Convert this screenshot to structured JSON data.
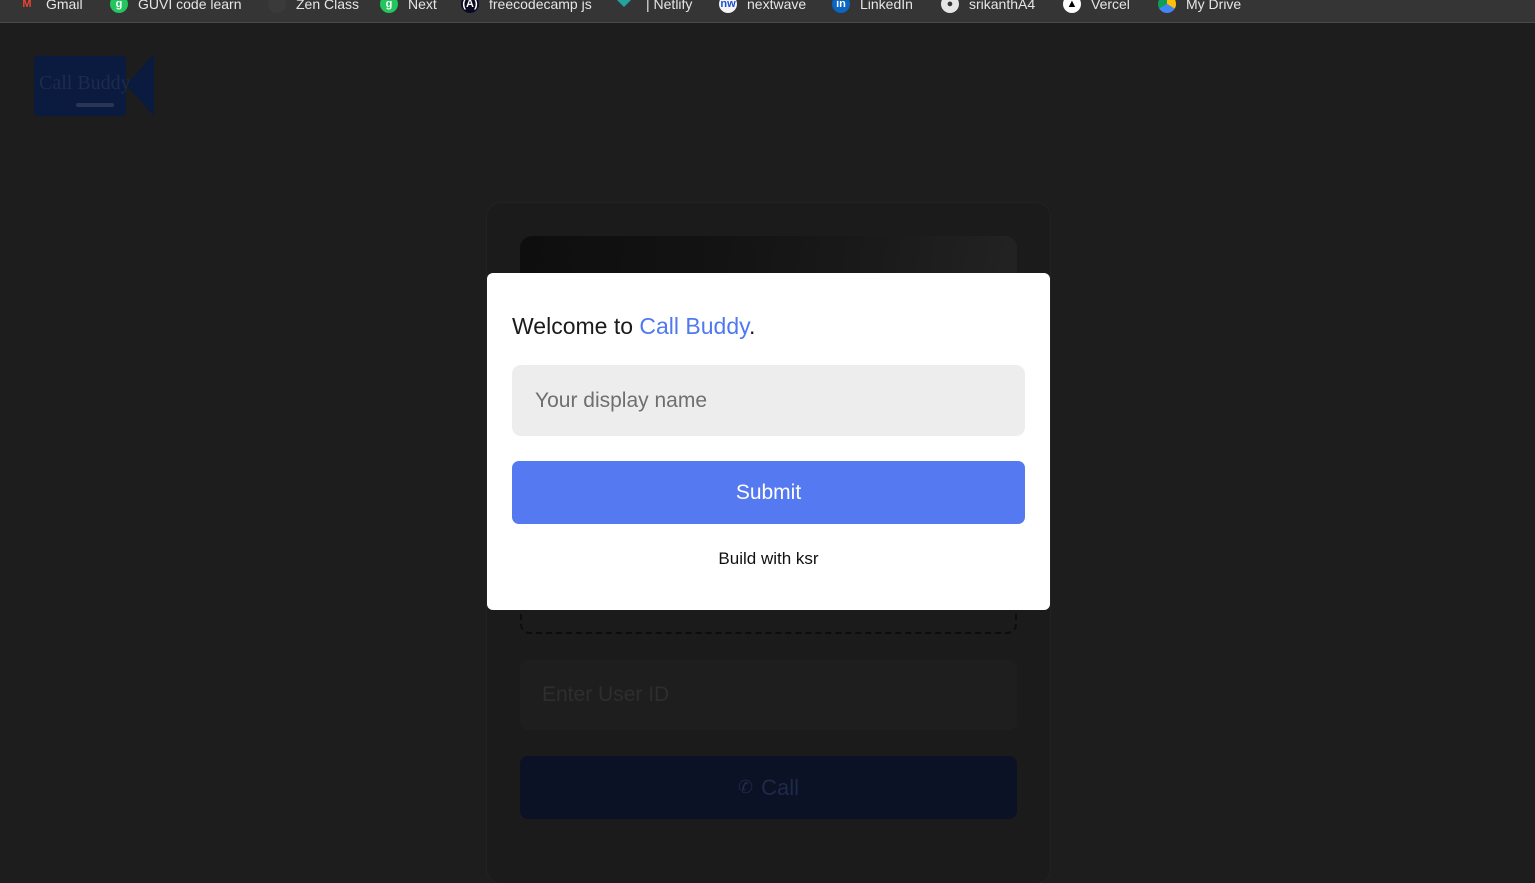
{
  "bookmarks": [
    {
      "label": "Gmail",
      "icon": "gmail-icon"
    },
    {
      "label": "GUVI code learn",
      "icon": "guvi-icon"
    },
    {
      "label": "Zen Class",
      "icon": "zen-icon"
    },
    {
      "label": "Next",
      "icon": "guvi-icon"
    },
    {
      "label": "freecodecamp js",
      "icon": "freecodecamp-icon"
    },
    {
      "label": "| Netlify",
      "icon": "netlify-icon"
    },
    {
      "label": "nextwave",
      "icon": "nextwave-icon"
    },
    {
      "label": "LinkedIn",
      "icon": "linkedin-icon"
    },
    {
      "label": "srikanthA4",
      "icon": "github-icon"
    },
    {
      "label": "Vercel",
      "icon": "vercel-icon"
    },
    {
      "label": "My Drive",
      "icon": "drive-icon"
    }
  ],
  "logo": {
    "text": "Call Buddy"
  },
  "background": {
    "user_id_placeholder": "Enter User ID",
    "call_label": "Call"
  },
  "modal": {
    "welcome_prefix": "Welcome to ",
    "brand": "Call Buddy",
    "welcome_suffix": ".",
    "name_placeholder": "Your display name",
    "name_value": "",
    "submit_label": "Submit",
    "footer": "Build with ksr"
  },
  "colors": {
    "accent": "#5579f0",
    "brand_text": "#5079f0",
    "page_bg": "#1d1d1d"
  }
}
